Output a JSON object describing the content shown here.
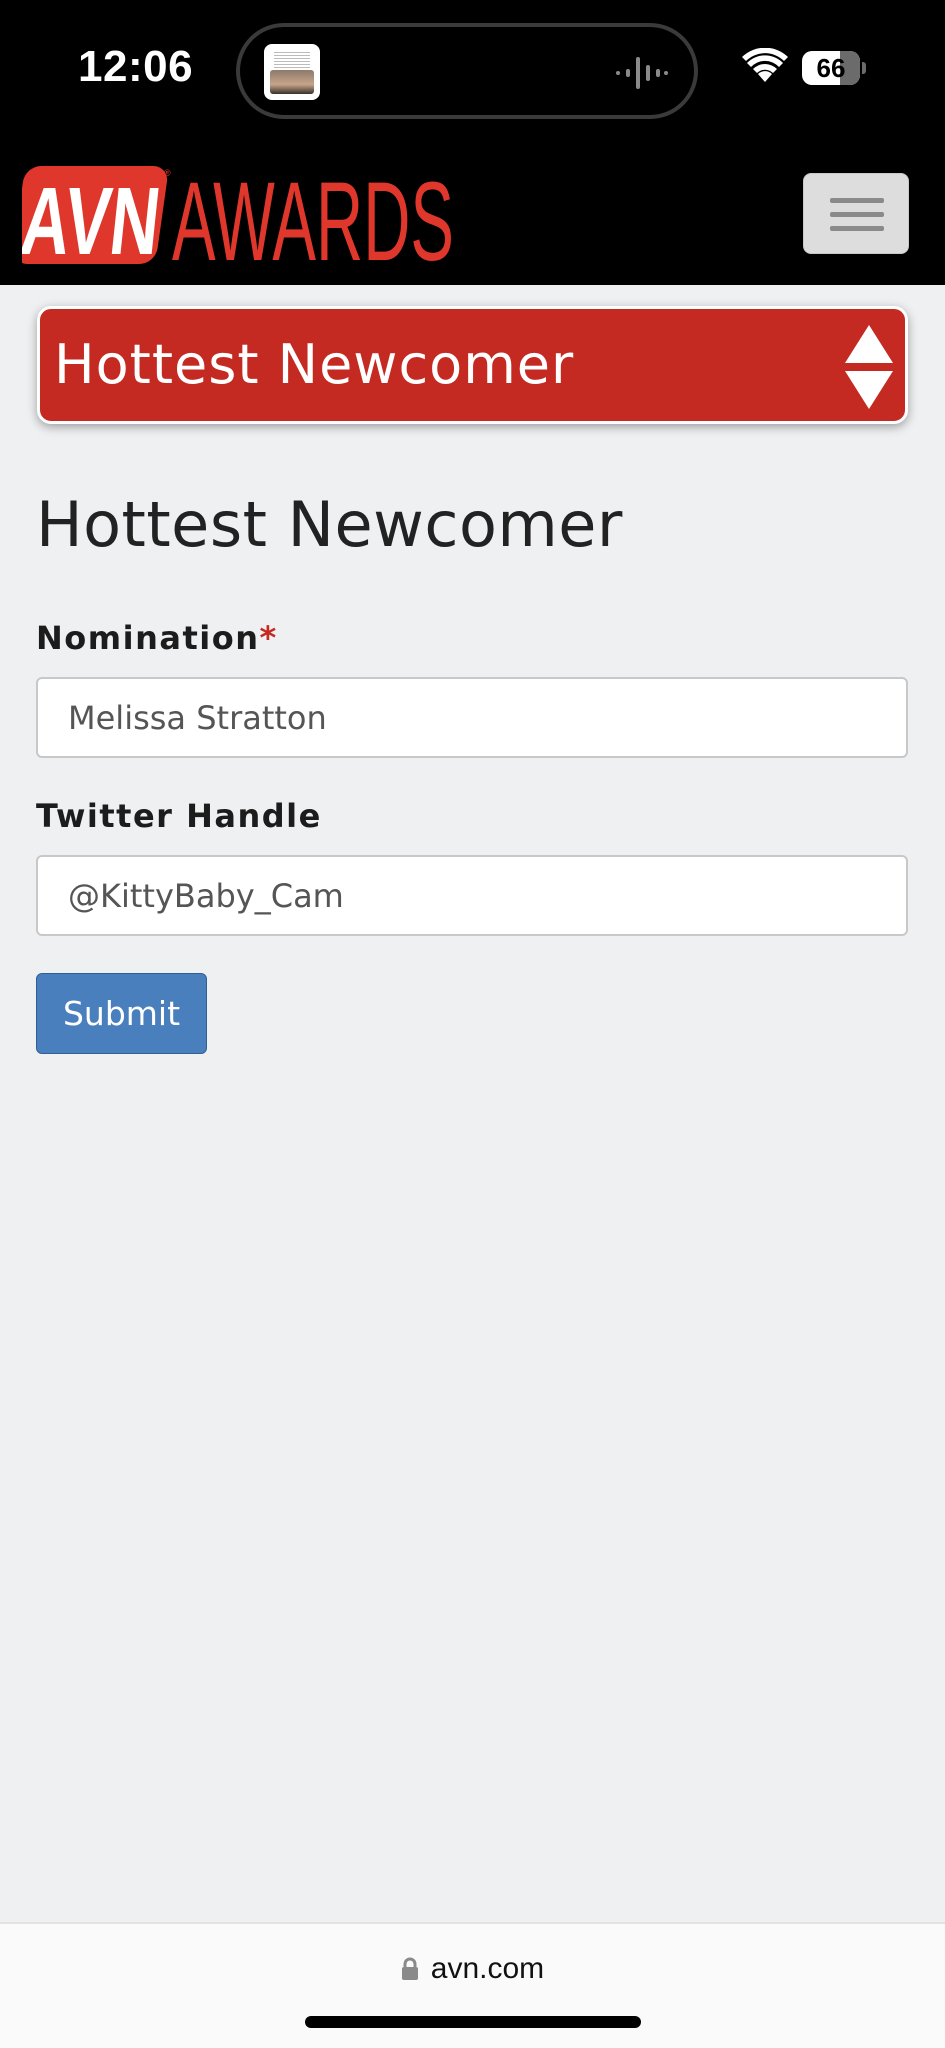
{
  "status_bar": {
    "time": "12:06",
    "battery": "66",
    "battery_level": 0.66,
    "icons": [
      "wifi-icon",
      "battery-icon",
      "audio-waveform-icon"
    ]
  },
  "header": {
    "logo_text": "AVN AWARDS",
    "logo_colors": {
      "primary": "#e0372c",
      "background": "#000000"
    },
    "menu_icon": "hamburger-icon"
  },
  "category_select": {
    "selected": "Hottest Newcomer",
    "background": "#c42a21"
  },
  "form": {
    "title": "Hottest Newcomer",
    "nomination_label": "Nomination",
    "required_marker": "*",
    "nomination_value": "Melissa Stratton",
    "twitter_label": "Twitter Handle",
    "twitter_value": "@KittyBaby_Cam",
    "submit_label": "Submit",
    "submit_color": "#4a7fbd"
  },
  "browser": {
    "url": "avn.com",
    "lock_icon": "lock-icon"
  }
}
